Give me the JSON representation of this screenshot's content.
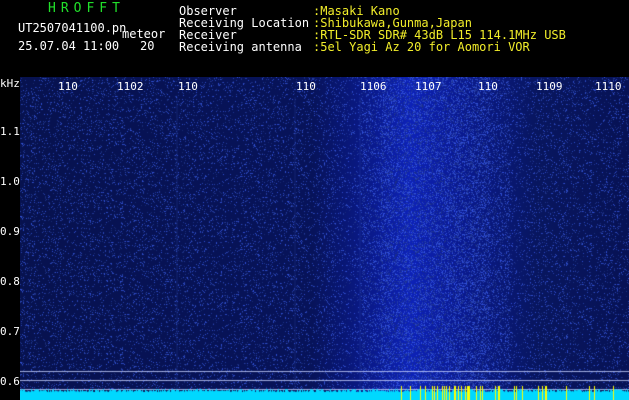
{
  "header": {
    "brand": "HROFFT",
    "filename": "UT2507041100.pn",
    "type_label": "meteor",
    "datetime": "25.07.04 11:00",
    "count": "20",
    "fields": [
      {
        "label": "Observer",
        "value": ":Masaki Kano"
      },
      {
        "label": "Receiving Location",
        "value": ":Shibukawa,Gunma,Japan"
      },
      {
        "label": "Receiver",
        "value": ":RTL-SDR SDR# 43dB L15 114.1MHz USB"
      },
      {
        "label": "Receiving antenna",
        "value": ":5el Yagi Az 20 for Aomori VOR"
      }
    ]
  },
  "axes": {
    "unit": "kHz",
    "y_ticks": [
      "1.1",
      "1.0",
      "0.9",
      "0.8",
      "0.7",
      "0.6"
    ],
    "x_ticks": [
      "110",
      "1102",
      "110",
      "110",
      "1106",
      "1107",
      "110",
      "1109",
      "1110"
    ]
  },
  "colors": {
    "background": "#000000",
    "brand": "#21e02a",
    "text": "#ffffff",
    "field_value": "#f2ee2a",
    "waterfall": "#0a1a8e",
    "baseline": "#00d8ff",
    "meteor": "#ffff00"
  }
}
